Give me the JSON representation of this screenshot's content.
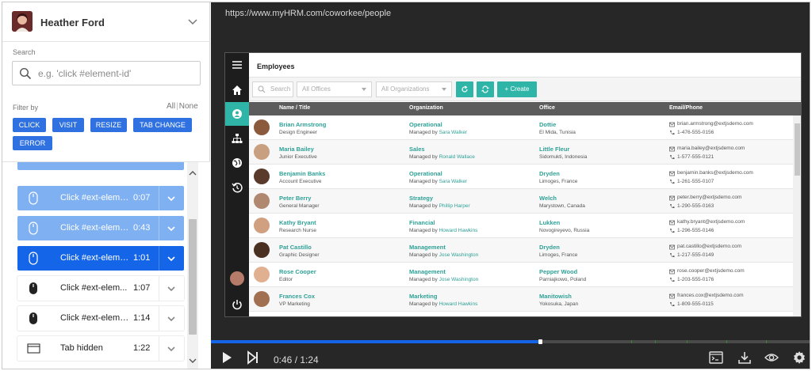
{
  "user": {
    "name": "Heather Ford"
  },
  "search": {
    "label": "Search",
    "placeholder": "e.g. 'click #element-id'"
  },
  "filter": {
    "label": "Filter by",
    "all": "All",
    "separator": "|",
    "none": "None",
    "chips": [
      "CLICK",
      "VISIT",
      "RESIZE",
      "TAB CHANGE",
      "ERROR"
    ]
  },
  "events": [
    {
      "label": "Click #ext-elemen...",
      "time": "0:07",
      "icon": "mouse-icon",
      "state": "light"
    },
    {
      "label": "Click #ext-elemen...",
      "time": "0:43",
      "icon": "mouse-icon",
      "state": "light"
    },
    {
      "label": "Click #ext-elemen...",
      "time": "1:01",
      "icon": "mouse-icon",
      "state": "active"
    },
    {
      "label": "Click #ext-elem...",
      "time": "1:07",
      "icon": "mouse-icon",
      "state": "plain"
    },
    {
      "label": "Click #ext-elemen...",
      "time": "1:14",
      "icon": "mouse-icon",
      "state": "plain"
    },
    {
      "label": "Tab hidden",
      "time": "1:22",
      "icon": "tab-icon",
      "state": "plain"
    }
  ],
  "player": {
    "url": "https://www.myHRM.com/coworkee/people",
    "time": "0:46 / 1:24",
    "progress": 0.5476
  },
  "app": {
    "title": "Employees",
    "toolbar": {
      "search_placeholder": "Search",
      "offices_placeholder": "All Offices",
      "organizations_placeholder": "All Organizations",
      "create_label": "+ Create"
    },
    "columns": [
      "Name / Title",
      "Organization",
      "Office",
      "Email/Phone"
    ],
    "employees": [
      {
        "name": "Brian Armstrong",
        "title": "Design Engineer",
        "org": "Operational",
        "managed_prefix": "Managed by ",
        "manager": "Sara Walker",
        "office": "Dottie",
        "location": "El Mida, Tunisia",
        "email": "brian.armstrong@extjsdemo.com",
        "phone": "1-476-555-0156"
      },
      {
        "name": "Maria Bailey",
        "title": "Junior Executive",
        "org": "Sales",
        "managed_prefix": "Managed by ",
        "manager": "Ronald Wallace",
        "office": "Little Fleur",
        "location": "Sidomukti, Indonesia",
        "email": "maria.bailey@extjsdemo.com",
        "phone": "1-577-555-0121"
      },
      {
        "name": "Benjamin Banks",
        "title": "Account Executive",
        "org": "Operational",
        "managed_prefix": "Managed by ",
        "manager": "Sara Walker",
        "office": "Dryden",
        "location": "Limoges, France",
        "email": "benjamin.banks@extjsdemo.com",
        "phone": "1-261-555-0107"
      },
      {
        "name": "Peter Berry",
        "title": "General Manager",
        "org": "Strategy",
        "managed_prefix": "Managed by ",
        "manager": "Phillip Harper",
        "office": "Welch",
        "location": "Marystown, Canada",
        "email": "peter.berry@extjsdemo.com",
        "phone": "1-290-555-0163"
      },
      {
        "name": "Kathy Bryant",
        "title": "Research Nurse",
        "org": "Financial",
        "managed_prefix": "Managed by ",
        "manager": "Howard Hawkins",
        "office": "Lukken",
        "location": "Novogireyevo, Russia",
        "email": "kathy.bryant@extjsdemo.com",
        "phone": "1-296-555-0146"
      },
      {
        "name": "Pat Castillo",
        "title": "Graphic Designer",
        "org": "Management",
        "managed_prefix": "Managed by ",
        "manager": "Jose Washington",
        "office": "Dryden",
        "location": "Limoges, France",
        "email": "pat.castillo@extjsdemo.com",
        "phone": "1-217-555-0149"
      },
      {
        "name": "Rose Cooper",
        "title": "Editor",
        "org": "Management",
        "managed_prefix": "Managed by ",
        "manager": "Jose Washington",
        "office": "Pepper Wood",
        "location": "Parniajkowo, Poland",
        "email": "rose.cooper@extjsdemo.com",
        "phone": "1-203-555-0176"
      },
      {
        "name": "Frances Cox",
        "title": "VP Marketing",
        "org": "Marketing",
        "managed_prefix": "Managed by ",
        "manager": "Howard Hawkins",
        "office": "Manitowish",
        "location": "Yokosuka, Japan",
        "email": "frances.cox@extjsdemo.com",
        "phone": "1-809-555-0115"
      }
    ]
  },
  "colors": {
    "accent": "#1565e8",
    "teal": "#2fb5a8",
    "chip": "#2f71e0",
    "player_bg": "#272727"
  }
}
